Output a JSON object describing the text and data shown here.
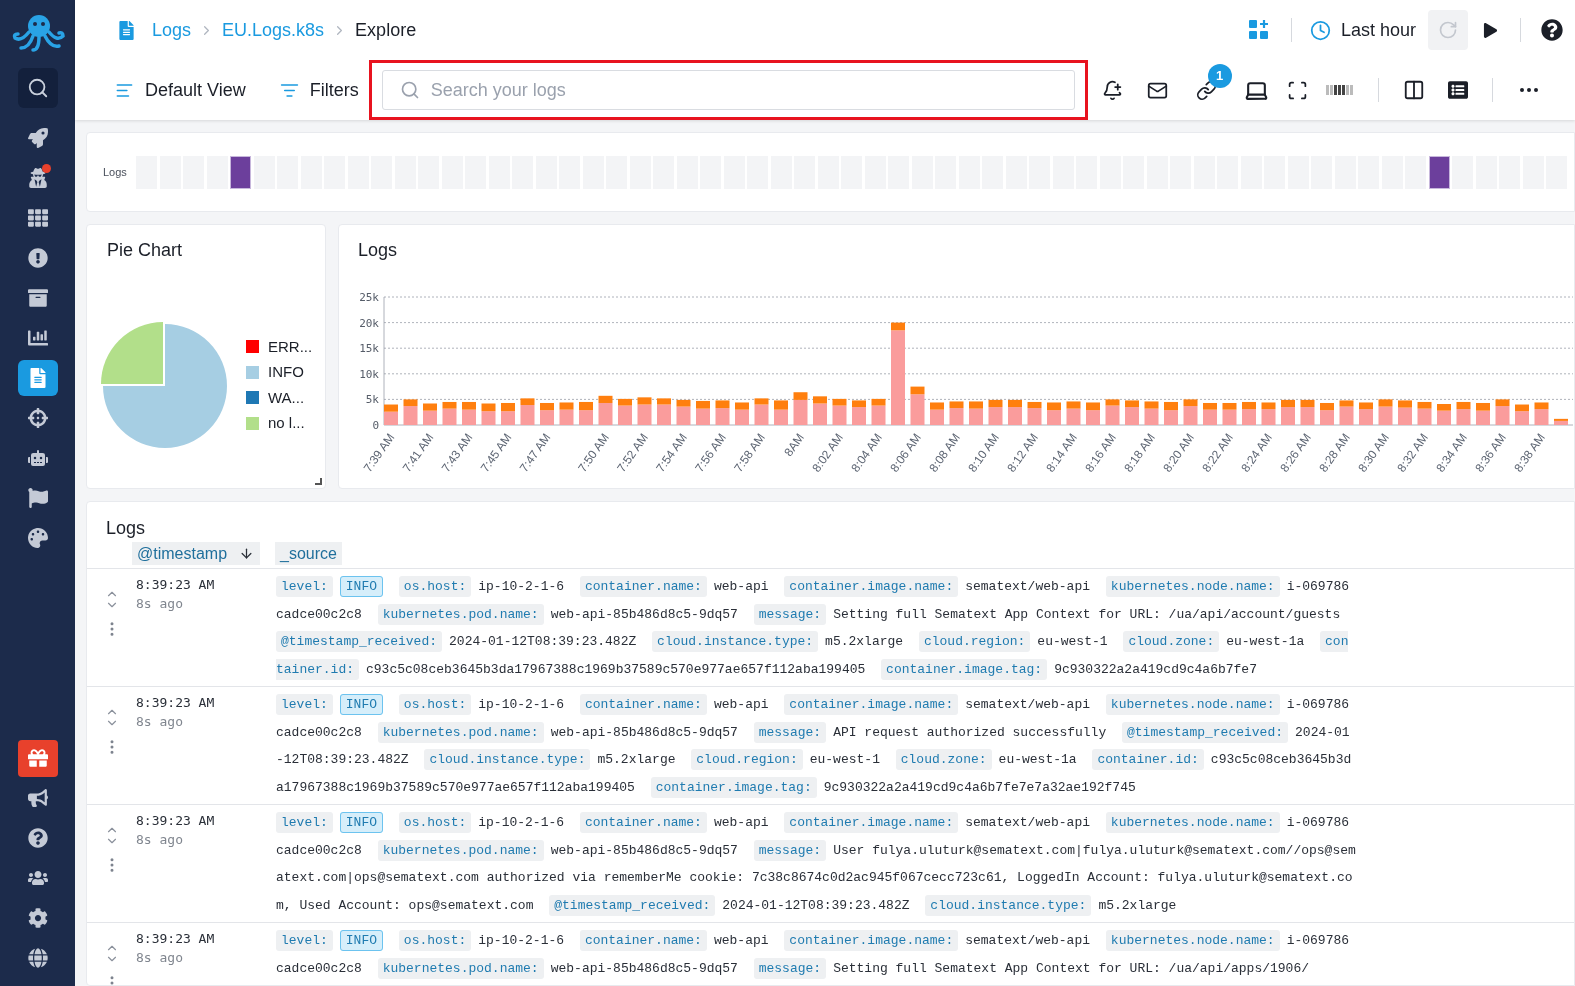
{
  "sidebar": {
    "items": [
      {
        "selected": false,
        "notification": false
      },
      {
        "selected": false,
        "notification": true
      },
      {
        "selected": false,
        "notification": false
      },
      {
        "selected": false,
        "notification": false
      },
      {
        "selected": false,
        "notification": false
      },
      {
        "selected": false,
        "notification": false
      },
      {
        "selected": true,
        "notification": false
      },
      {
        "selected": false,
        "notification": false
      },
      {
        "selected": false,
        "notification": false
      },
      {
        "selected": false,
        "notification": false
      },
      {
        "selected": false,
        "notification": false
      }
    ],
    "bottom_items": [
      {
        "highlighted": true
      },
      {
        "highlighted": false
      },
      {
        "highlighted": false
      },
      {
        "highlighted": false
      },
      {
        "highlighted": false
      },
      {
        "highlighted": false
      }
    ]
  },
  "breadcrumb": [
    {
      "label": "Logs",
      "link": true
    },
    {
      "label": "EU.Logs.k8s",
      "link": true
    },
    {
      "label": "Explore",
      "link": false
    }
  ],
  "time_range": {
    "label": "Last hour"
  },
  "refresh": {
    "disabled": true
  },
  "toolbar": {
    "view": "Default View",
    "filters": "Filters",
    "search": {
      "placeholder": "Search your logs",
      "highlighted": true
    },
    "link_badge": "1"
  },
  "timeline": {
    "label": "Logs",
    "cells": [
      {
        "marked": false
      },
      {
        "marked": false
      },
      {
        "marked": false
      },
      {
        "marked": false
      },
      {
        "marked": true
      },
      {
        "marked": false
      },
      {
        "marked": false
      },
      {
        "marked": false
      },
      {
        "marked": false
      },
      {
        "marked": false
      },
      {
        "marked": false
      },
      {
        "marked": false
      },
      {
        "marked": false
      },
      {
        "marked": false
      },
      {
        "marked": false
      },
      {
        "marked": false
      },
      {
        "marked": false
      },
      {
        "marked": false
      },
      {
        "marked": false
      },
      {
        "marked": false
      },
      {
        "marked": false
      },
      {
        "marked": false
      },
      {
        "marked": false
      },
      {
        "marked": false
      },
      {
        "marked": false
      },
      {
        "marked": false
      },
      {
        "marked": false
      },
      {
        "marked": false
      },
      {
        "marked": false
      },
      {
        "marked": false
      },
      {
        "marked": false
      },
      {
        "marked": false
      },
      {
        "marked": false
      },
      {
        "marked": false
      },
      {
        "marked": false
      },
      {
        "marked": false
      },
      {
        "marked": false
      },
      {
        "marked": false
      },
      {
        "marked": false
      },
      {
        "marked": false
      },
      {
        "marked": false
      },
      {
        "marked": false
      },
      {
        "marked": false
      },
      {
        "marked": false
      },
      {
        "marked": false
      },
      {
        "marked": false
      },
      {
        "marked": false
      },
      {
        "marked": false
      },
      {
        "marked": false
      },
      {
        "marked": false
      },
      {
        "marked": false
      },
      {
        "marked": false
      },
      {
        "marked": false
      },
      {
        "marked": false
      },
      {
        "marked": false
      },
      {
        "marked": true
      },
      {
        "marked": false
      },
      {
        "marked": false
      },
      {
        "marked": false
      },
      {
        "marked": false
      },
      {
        "marked": false
      }
    ]
  },
  "pie_panel": {
    "title": "Pie Chart",
    "legend": [
      {
        "label": "ERR...",
        "color": "#ff0000"
      },
      {
        "label": "INFO",
        "color": "#a6cee3"
      },
      {
        "label": "WA...",
        "color": "#1f78b4"
      },
      {
        "label": "no l...",
        "color": "#b2df8a"
      }
    ]
  },
  "chart_panel": {
    "title": "Logs",
    "chart_data": {
      "type": "bar",
      "stacked": true,
      "grid": true,
      "categories": [
        "7:39 AM",
        null,
        "7:41 AM",
        null,
        "7:43 AM",
        null,
        "7:45 AM",
        null,
        "7:47 AM",
        null,
        null,
        "7:50 AM",
        null,
        "7:52 AM",
        null,
        "7:54 AM",
        null,
        "7:56 AM",
        null,
        "7:58 AM",
        null,
        "8AM",
        null,
        "8:02 AM",
        null,
        "8:04 AM",
        null,
        "8:06 AM",
        null,
        "8:08 AM",
        null,
        "8:10 AM",
        null,
        "8:12 AM",
        null,
        "8:14 AM",
        null,
        "8:16 AM",
        null,
        "8:18 AM",
        null,
        "8:20 AM",
        null,
        "8:22 AM",
        null,
        "8:24 AM",
        null,
        "8:26 AM",
        null,
        "8:28 AM",
        null,
        "8:30 AM",
        null,
        "8:32 AM",
        null,
        "8:34 AM",
        null,
        "8:36 AM",
        null,
        "8:38 AM",
        null
      ],
      "series": [
        {
          "color": "#fa9c9c",
          "values": [
            2600,
            3700,
            2800,
            3200,
            3000,
            2700,
            2700,
            3900,
            2900,
            3000,
            2900,
            4300,
            3800,
            4000,
            4000,
            3600,
            3200,
            3300,
            3000,
            4000,
            3000,
            4900,
            4200,
            3800,
            3500,
            3800,
            18500,
            6000,
            3000,
            3300,
            3200,
            3500,
            3500,
            3300,
            2900,
            3200,
            2900,
            3800,
            3500,
            3200,
            2900,
            3700,
            3000,
            3000,
            3100,
            3100,
            3500,
            3500,
            2900,
            3600,
            3100,
            3600,
            3400,
            3200,
            2800,
            3100,
            2800,
            3700,
            2700,
            3100,
            800
          ]
        },
        {
          "color": "#ff7f0e",
          "values": [
            1400,
            1300,
            1400,
            1300,
            1500,
            1500,
            1600,
            1300,
            1400,
            1400,
            1600,
            1400,
            1300,
            1400,
            1200,
            1300,
            1500,
            1500,
            1400,
            1200,
            1800,
            1500,
            1400,
            1300,
            1300,
            1300,
            1500,
            1500,
            1400,
            1300,
            1400,
            1400,
            1400,
            1200,
            1500,
            1400,
            1500,
            1200,
            1300,
            1400,
            1600,
            1300,
            1300,
            1300,
            1400,
            1300,
            1400,
            1400,
            1400,
            1200,
            1300,
            1400,
            1400,
            1300,
            1300,
            1400,
            1500,
            1300,
            1300,
            1300,
            400
          ]
        }
      ],
      "ylim": [
        0,
        25000
      ],
      "yticks": [
        {
          "value": 0,
          "label": "0"
        },
        {
          "value": 5000,
          "label": "5k"
        },
        {
          "value": 10000,
          "label": "10k"
        },
        {
          "value": 15000,
          "label": "15k"
        },
        {
          "value": 20000,
          "label": "20k"
        },
        {
          "value": 25000,
          "label": "25k"
        }
      ]
    }
  },
  "logs_panel": {
    "title": "Logs",
    "columns": [
      {
        "label": "@timestamp",
        "sorted": true
      },
      {
        "label": "_source",
        "sorted": false
      }
    ],
    "rows": [
      {
        "time": "8:39:23 AM",
        "ago": "8s ago",
        "fields": [
          {
            "key": "level:",
            "value": "INFO",
            "highlighted": true
          },
          {
            "key": "os.host:",
            "value": "ip-10-2-1-6",
            "highlighted": false
          },
          {
            "key": "container.name:",
            "value": "web-api",
            "highlighted": false
          },
          {
            "key": "container.image.name:",
            "value": "sematext/web-api",
            "highlighted": false
          },
          {
            "key": "kubernetes.node.name:",
            "value": "i-069786cadce00c2c8",
            "highlighted": false
          },
          {
            "key": "kubernetes.pod.name:",
            "value": "web-api-85b486d8c5-9dq57",
            "highlighted": false
          },
          {
            "key": "message:",
            "value": "Setting full Sematext App Context for URL: /ua/api/account/guests",
            "highlighted": false
          },
          {
            "key": "@timestamp_received:",
            "value": "2024-01-12T08:39:23.482Z",
            "highlighted": false
          },
          {
            "key": "cloud.instance.type:",
            "value": "m5.2xlarge",
            "highlighted": false
          },
          {
            "key": "cloud.region:",
            "value": "eu-west-1",
            "highlighted": false
          },
          {
            "key": "cloud.zone:",
            "value": "eu-west-1a",
            "highlighted": false
          },
          {
            "key": "container.id:",
            "value": "c93c5c08ceb3645b3da17967388c1969b37589c570e977ae657f112aba199405",
            "highlighted": false
          },
          {
            "key": "container.image.tag:",
            "value": "9c930322a2a419cd9c4a6b7fe7",
            "highlighted": false
          }
        ]
      },
      {
        "time": "8:39:23 AM",
        "ago": "8s ago",
        "fields": [
          {
            "key": "level:",
            "value": "INFO",
            "highlighted": true
          },
          {
            "key": "os.host:",
            "value": "ip-10-2-1-6",
            "highlighted": false
          },
          {
            "key": "container.name:",
            "value": "web-api",
            "highlighted": false
          },
          {
            "key": "container.image.name:",
            "value": "sematext/web-api",
            "highlighted": false
          },
          {
            "key": "kubernetes.node.name:",
            "value": "i-069786cadce00c2c8",
            "highlighted": false
          },
          {
            "key": "kubernetes.pod.name:",
            "value": "web-api-85b486d8c5-9dq57",
            "highlighted": false
          },
          {
            "key": "message:",
            "value": "API request authorized successfully",
            "highlighted": false
          },
          {
            "key": "@timestamp_received:",
            "value": "2024-01-12T08:39:23.482Z",
            "highlighted": false
          },
          {
            "key": "cloud.instance.type:",
            "value": "m5.2xlarge",
            "highlighted": false
          },
          {
            "key": "cloud.region:",
            "value": "eu-west-1",
            "highlighted": false
          },
          {
            "key": "cloud.zone:",
            "value": "eu-west-1a",
            "highlighted": false
          },
          {
            "key": "container.id:",
            "value": "c93c5c08ceb3645b3da17967388c1969b37589c570e977ae657f112aba199405",
            "highlighted": false
          },
          {
            "key": "container.image.tag:",
            "value": "9c930322a2a419cd9c4a6b7fe7e7a32ae192f745",
            "highlighted": false
          }
        ]
      },
      {
        "time": "8:39:23 AM",
        "ago": "8s ago",
        "fields": [
          {
            "key": "level:",
            "value": "INFO",
            "highlighted": true
          },
          {
            "key": "os.host:",
            "value": "ip-10-2-1-6",
            "highlighted": false
          },
          {
            "key": "container.name:",
            "value": "web-api",
            "highlighted": false
          },
          {
            "key": "container.image.name:",
            "value": "sematext/web-api",
            "highlighted": false
          },
          {
            "key": "kubernetes.node.name:",
            "value": "i-069786cadce00c2c8",
            "highlighted": false
          },
          {
            "key": "kubernetes.pod.name:",
            "value": "web-api-85b486d8c5-9dq57",
            "highlighted": false
          },
          {
            "key": "message:",
            "value": "User fulya.uluturk@sematext.com|fulya.uluturk@sematext.com//ops@sematext.com|ops@sematext.com authorized via rememberMe cookie: 7c38c8674c0d2ac945f067cecc723c61, LoggedIn Account: fulya.uluturk@sematext.com, Used Account: ops@sematext.com",
            "highlighted": false
          },
          {
            "key": "@timestamp_received:",
            "value": "2024-01-12T08:39:23.482Z",
            "highlighted": false
          },
          {
            "key": "cloud.instance.type:",
            "value": "m5.2xlarge",
            "highlighted": false
          }
        ]
      },
      {
        "time": "8:39:23 AM",
        "ago": "8s ago",
        "fields": [
          {
            "key": "level:",
            "value": "INFO",
            "highlighted": true
          },
          {
            "key": "os.host:",
            "value": "ip-10-2-1-6",
            "highlighted": false
          },
          {
            "key": "container.name:",
            "value": "web-api",
            "highlighted": false
          },
          {
            "key": "container.image.name:",
            "value": "sematext/web-api",
            "highlighted": false
          },
          {
            "key": "kubernetes.node.name:",
            "value": "i-069786cadce00c2c8",
            "highlighted": false
          },
          {
            "key": "kubernetes.pod.name:",
            "value": "web-api-85b486d8c5-9dq57",
            "highlighted": false
          },
          {
            "key": "message:",
            "value": "Setting full Sematext App Context for URL: /ua/api/apps/1906/",
            "highlighted": false
          }
        ]
      }
    ]
  }
}
